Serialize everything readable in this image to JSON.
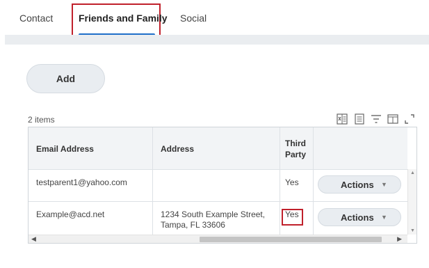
{
  "tabs": [
    {
      "label": "Contact"
    },
    {
      "label": "Friends and Family"
    },
    {
      "label": "Social"
    }
  ],
  "add_button": {
    "label": "Add"
  },
  "grid": {
    "item_count": "2 items",
    "toolbar_icons": [
      "export-excel-icon",
      "print-icon",
      "filter-icon",
      "columns-icon",
      "fullscreen-icon"
    ],
    "columns": [
      "Email Address",
      "Address",
      "Third Party",
      ""
    ],
    "rows": [
      {
        "email": "testparent1@yahoo.com",
        "address": "",
        "third_party": "Yes",
        "actions_label": "Actions"
      },
      {
        "email": "Example@acd.net",
        "address": "1234 South Example Street, Tampa, FL 33606",
        "third_party": "Yes",
        "actions_label": "Actions"
      }
    ]
  },
  "colors": {
    "highlight": "#c0202b",
    "tab_underline": "#1f6fc9"
  }
}
